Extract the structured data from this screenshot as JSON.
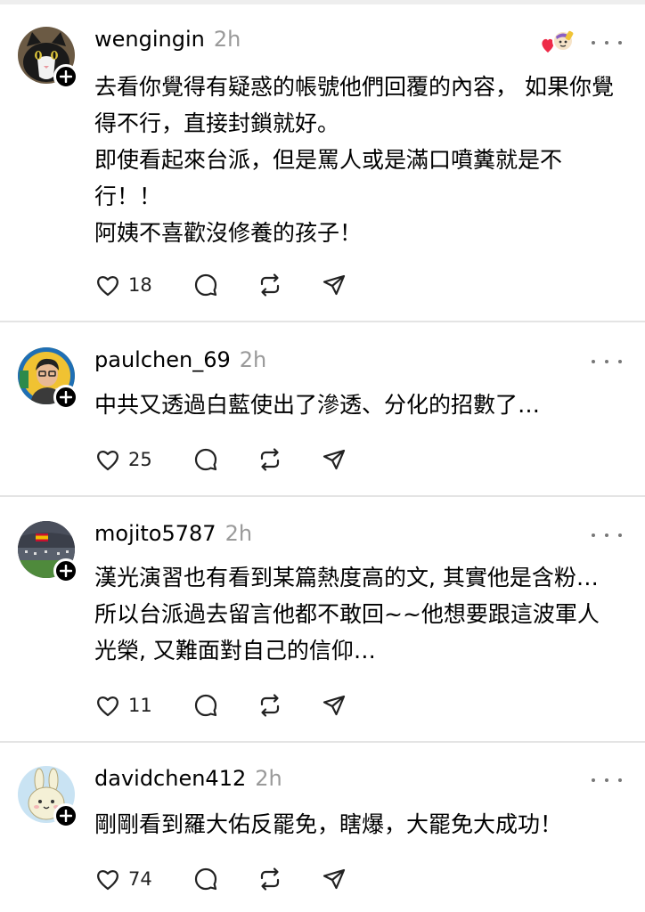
{
  "posts": [
    {
      "username": "wengingin",
      "time": "2h",
      "text": "去看你覺得有疑惑的帳號他們回覆的內容， 如果你覺得不行，直接封鎖就好。\n即使看起來台派，但是罵人或是滿口噴糞就是不行！！\n阿姨不喜歡沒修養的孩子！",
      "likes": "18",
      "avatar": "cat-avatar",
      "reactions": [
        "heart-reaction-icon",
        "emoji-reaction-icon"
      ]
    },
    {
      "username": "paulchen_69",
      "time": "2h",
      "text": "中共又透過白藍使出了滲透、分化的招數了…",
      "likes": "25",
      "avatar": "person-avatar"
    },
    {
      "username": "mojito5787",
      "time": "2h",
      "text": "漢光演習也有看到某篇熱度高的文, 其實他是含粉…所以台派過去留言他都不敢回~~他想要跟這波軍人光榮, 又難面對自己的信仰…",
      "likes": "11",
      "avatar": "stadium-avatar"
    },
    {
      "username": "davidchen412",
      "time": "2h",
      "text": "剛剛看到羅大佑反罷免，瞎爆，大罷免大成功！",
      "likes": "74",
      "avatar": "rabbit-avatar"
    }
  ],
  "colors": {
    "username": "#000000",
    "timestamp": "#9a9a9a",
    "divider": "#e4e4e4",
    "icon": "#222222"
  }
}
